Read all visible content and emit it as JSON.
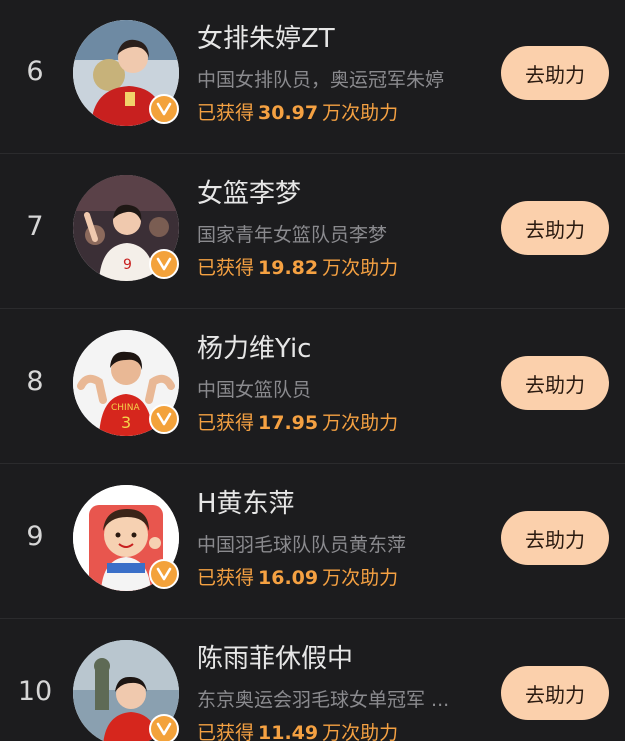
{
  "ranking": {
    "entries": [
      {
        "rank": "6",
        "name": "女排朱婷ZT",
        "description": "中国女排队员，奥运冠军朱婷",
        "support_prefix": "已获得",
        "support_value": "30.97",
        "support_suffix": "万次助力",
        "button_label": "去助力",
        "avatar_icon": "volleyball-player-avatar",
        "badge_icon": "verified-v-icon"
      },
      {
        "rank": "7",
        "name": "女篮李梦",
        "description": "国家青年女篮队员李梦",
        "support_prefix": "已获得",
        "support_value": "19.82",
        "support_suffix": "万次助力",
        "button_label": "去助力",
        "avatar_icon": "basketball-player-avatar",
        "badge_icon": "verified-v-icon"
      },
      {
        "rank": "8",
        "name": "杨力维Yic",
        "description": "中国女篮队员",
        "support_prefix": "已获得",
        "support_value": "17.95",
        "support_suffix": "万次助力",
        "button_label": "去助力",
        "avatar_icon": "basketball-player-avatar",
        "badge_icon": "verified-v-icon"
      },
      {
        "rank": "9",
        "name": "H黄东萍",
        "description": "中国羽毛球队队员黄东萍",
        "support_prefix": "已获得",
        "support_value": "16.09",
        "support_suffix": "万次助力",
        "button_label": "去助力",
        "avatar_icon": "cartoon-avatar",
        "badge_icon": "verified-v-icon"
      },
      {
        "rank": "10",
        "name": "陈雨菲休假中",
        "description": "东京奥运会羽毛球女单冠军 ...",
        "support_prefix": "已获得",
        "support_value": "11.49",
        "support_suffix": "万次助力",
        "button_label": "去助力",
        "avatar_icon": "badminton-player-avatar",
        "badge_icon": "verified-v-icon"
      }
    ]
  },
  "colors": {
    "background": "#1c1c1e",
    "support_text": "#f5a142",
    "button_bg": "#fbd0ac",
    "badge": "#f3a23b"
  }
}
